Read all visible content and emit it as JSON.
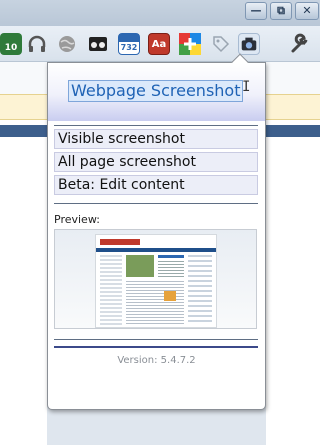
{
  "window": {
    "minimize_glyph": "—",
    "maximize_glyph": "⧉",
    "close_glyph": "✕"
  },
  "toolbar": {
    "extensions": [
      {
        "name": "calendar-badge-icon",
        "badge": "10",
        "color": "#2f7a3a"
      },
      {
        "name": "headphones-icon",
        "color": "#555555"
      },
      {
        "name": "globe-icon",
        "color": "#7a7a7a"
      },
      {
        "name": "binoculars-icon",
        "color": "#222222"
      },
      {
        "name": "calendar-732-icon",
        "badge": "732",
        "color": "#2c67b1"
      },
      {
        "name": "dictionary-icon",
        "badge": "Aa",
        "color": "#c0392b"
      },
      {
        "name": "plus-icon",
        "color": "#333333"
      },
      {
        "name": "tag-icon",
        "color": "#9aa5b1"
      },
      {
        "name": "camera-icon",
        "color": "#2a2f3a"
      },
      {
        "name": "wrench-icon",
        "color": "#444444"
      }
    ]
  },
  "popup": {
    "title": "Webpage Screenshot",
    "menu": [
      {
        "label": "Visible screenshot"
      },
      {
        "label": "All page screenshot"
      },
      {
        "label": "Beta: Edit content"
      }
    ],
    "preview_label": "Preview:",
    "version": "Version: 5.4.7.2"
  }
}
